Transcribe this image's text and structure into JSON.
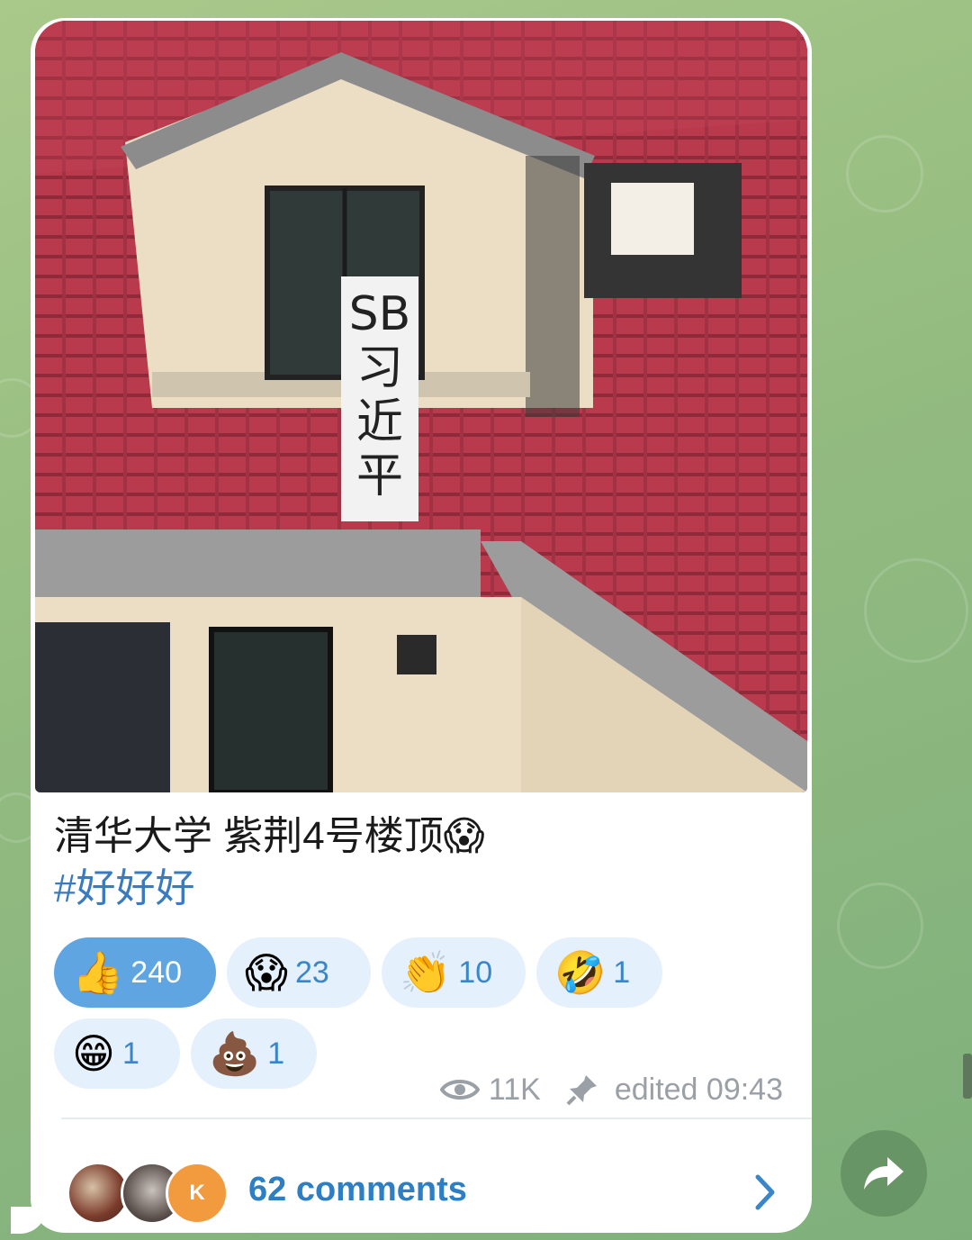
{
  "post": {
    "caption_line1": "清华大学 紫荆4号楼顶😱",
    "hashtag": "#好好好",
    "photo": {
      "banner_text": "SB习近平",
      "alt": "photo-banner"
    }
  },
  "reactions": [
    {
      "emoji": "👍",
      "count": "240",
      "active": true
    },
    {
      "emoji": "😱",
      "count": "23",
      "active": false
    },
    {
      "emoji": "👏",
      "count": "10",
      "active": false
    },
    {
      "emoji": "🤣",
      "count": "1",
      "active": false
    },
    {
      "emoji": "😁",
      "count": "1",
      "active": false
    },
    {
      "emoji": "💩",
      "count": "1",
      "active": false
    }
  ],
  "meta": {
    "views": "11K",
    "edited_label": "edited 09:43",
    "views_icon": "eye-icon",
    "pin_icon": "pin-icon"
  },
  "comments": {
    "label": "62 comments",
    "avatar_letter": "K",
    "chevron_icon": "chevron-right-icon"
  },
  "colors": {
    "accent": "#3a86c9",
    "active_chip": "#5ea5e2",
    "chip": "#e4f0fb",
    "roof": "#b6394a"
  }
}
